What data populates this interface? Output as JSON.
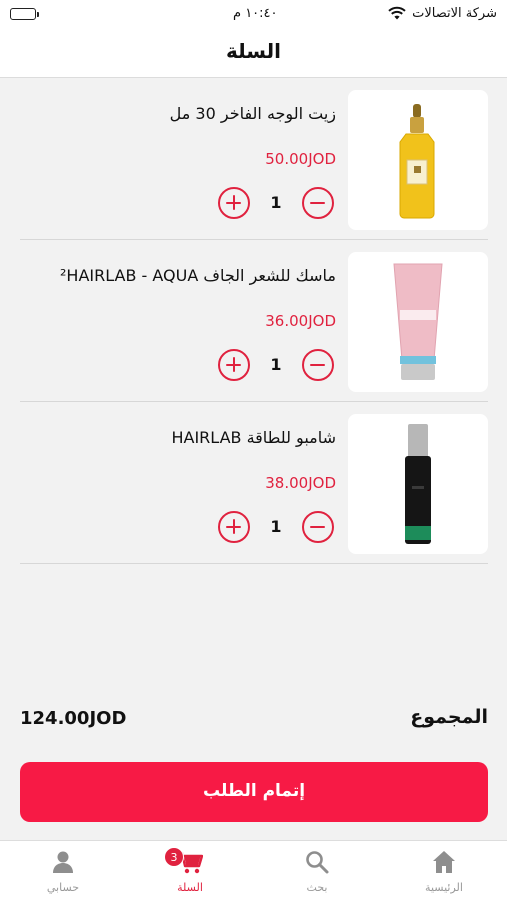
{
  "status_bar": {
    "carrier": "شركة الاتصالات",
    "time": "١٠:٤٠ م"
  },
  "header": {
    "title": "السلة"
  },
  "cart": {
    "items": [
      {
        "name": "زيت الوجه الفاخر 30 مل",
        "price": "50.00JOD",
        "quantity": "1",
        "image_icon": "gold-oil-dropper-bottle"
      },
      {
        "name": "ماسك للشعر الجاف ²HAIRLAB - AQUA",
        "price": "36.00JOD",
        "quantity": "1",
        "image_icon": "pink-hair-mask-tube"
      },
      {
        "name": "شامبو للطاقة HAIRLAB",
        "price": "38.00JOD",
        "quantity": "1",
        "image_icon": "black-shampoo-bottle"
      }
    ]
  },
  "summary": {
    "total_label": "المجموع",
    "total_value": "124.00JOD"
  },
  "checkout": {
    "label": "إتمام الطلب"
  },
  "tabs": {
    "account": {
      "label": "حسابي",
      "icon": "person-icon"
    },
    "cart": {
      "label": "السلة",
      "icon": "cart-icon",
      "badge": "3"
    },
    "search": {
      "label": "بحث",
      "icon": "search-icon"
    },
    "home": {
      "label": "الرئيسية",
      "icon": "home-icon"
    }
  },
  "colors": {
    "accent": "#e0223f",
    "checkout_bg": "#f71a45",
    "background": "#f2f2f2"
  }
}
